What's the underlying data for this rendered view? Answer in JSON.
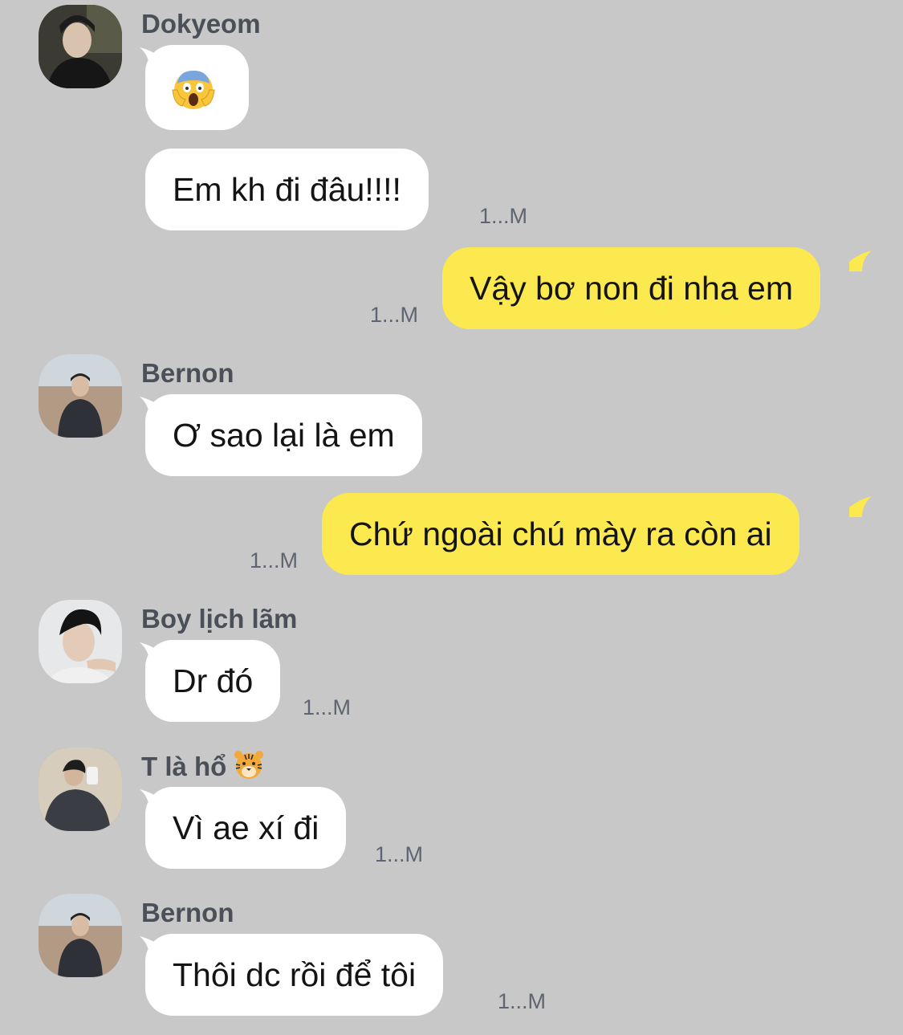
{
  "messages": [
    {
      "sender": "Dokyeom",
      "type": "emoji",
      "emoji": "face-screaming-in-fear",
      "direction": "in"
    },
    {
      "sender": "Dokyeom",
      "text": "Em kh đi đâu!!!!",
      "time": "1...M",
      "direction": "in"
    },
    {
      "sender": "",
      "text": "Vậy bơ non đi nha em",
      "time": "1...M",
      "direction": "out"
    },
    {
      "sender": "Bernon",
      "text": "Ơ sao lại là em",
      "time": "",
      "direction": "in"
    },
    {
      "sender": "",
      "text": "Chứ ngoài chú mày ra còn ai",
      "time": "1...M",
      "direction": "out"
    },
    {
      "sender": "Boy lịch lãm",
      "text": "Dr đó",
      "time": "1...M",
      "direction": "in"
    },
    {
      "sender": "T là hổ",
      "sender_emoji": "tiger-face",
      "text": "Vì ae xí đi",
      "time": "1...M",
      "direction": "in"
    },
    {
      "sender": "Bernon",
      "text": "Thôi dc rồi để tôi",
      "time": "1...M",
      "direction": "in"
    }
  ],
  "colors": {
    "background": "#c8c8c8",
    "incoming_bubble": "#ffffff",
    "outgoing_bubble": "#fbe94f",
    "sender_name": "#4a4f58",
    "timestamp": "#5e6470"
  }
}
